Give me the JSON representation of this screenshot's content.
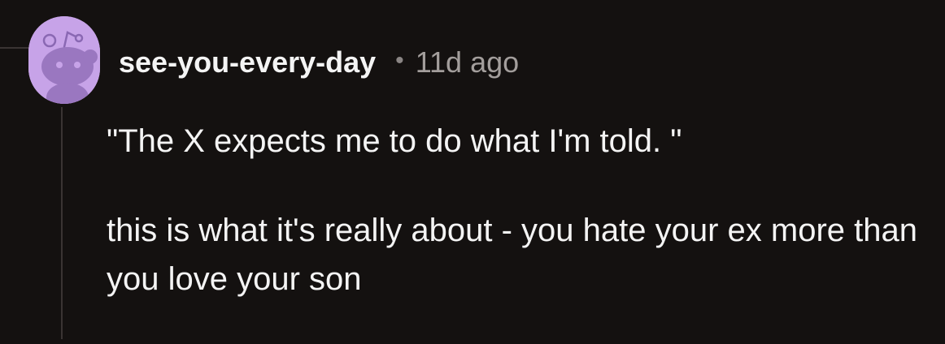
{
  "comment": {
    "author": "see-you-every-day",
    "separator": "•",
    "time_ago": "11d ago",
    "paragraphs": [
      "\"The X expects me to do what I'm told. \"",
      "this is what it's really about - you hate your ex more than you love your son"
    ],
    "avatar": {
      "icon": "reddit-snoo-icon",
      "background_color": "#c7a3e8",
      "figure_color": "#9a77c0"
    }
  }
}
